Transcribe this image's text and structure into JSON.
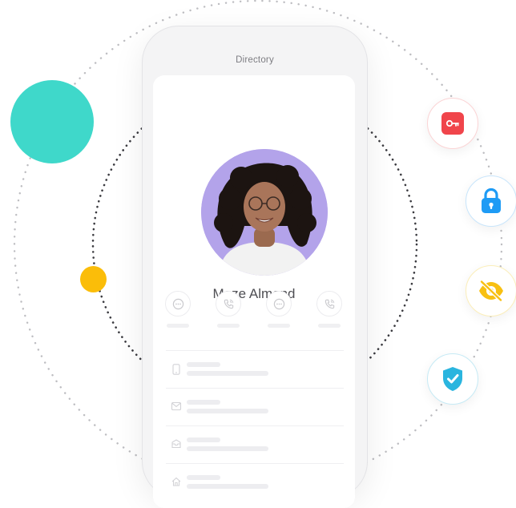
{
  "header": {
    "title": "Directory"
  },
  "contact": {
    "name": "Maze Almond"
  },
  "actions": [
    {
      "icon": "chat-icon"
    },
    {
      "icon": "phone-icon"
    },
    {
      "icon": "chat-icon"
    },
    {
      "icon": "phone-icon"
    }
  ],
  "details": [
    {
      "icon": "mobile-icon"
    },
    {
      "icon": "email-icon"
    },
    {
      "icon": "inbox-icon"
    },
    {
      "icon": "home-icon"
    }
  ],
  "badges": [
    {
      "icon": "key-icon",
      "color": "#f0454b"
    },
    {
      "icon": "lock-icon",
      "color": "#1e9bf5"
    },
    {
      "icon": "eye-off-icon",
      "color": "#f8c012"
    },
    {
      "icon": "shield-check-icon",
      "color": "#2ab5df"
    }
  ],
  "colors": {
    "teal": "#3fd8ca",
    "yellow": "#fbbd09",
    "avatar_bg": "#b3a3ea"
  }
}
